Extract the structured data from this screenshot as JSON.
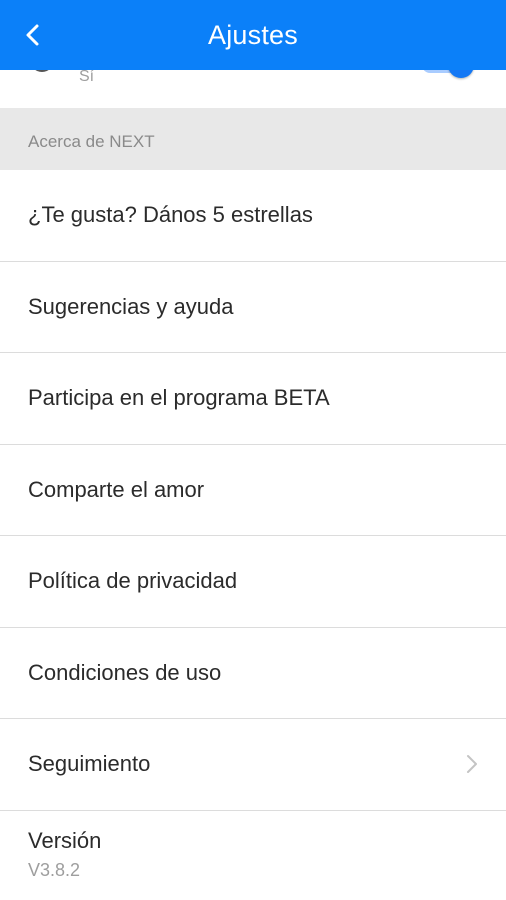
{
  "header": {
    "title": "Ajustes",
    "back_icon": "chevron-left-icon",
    "color": "#0b80f9"
  },
  "previous_row": {
    "subtitle": "Sí",
    "toggle_on": true
  },
  "section": {
    "title": "Acerca de NEXT"
  },
  "items": [
    {
      "label": "¿Te gusta? Dános 5 estrellas"
    },
    {
      "label": "Sugerencias y ayuda"
    },
    {
      "label": "Participa en el programa BETA"
    },
    {
      "label": "Comparte el amor"
    },
    {
      "label": "Política de privacidad"
    },
    {
      "label": "Condiciones de uso"
    },
    {
      "label": "Seguimiento",
      "icon": "chevron-right-icon"
    }
  ],
  "version": {
    "title": "Versión",
    "value": "V3.8.2"
  }
}
